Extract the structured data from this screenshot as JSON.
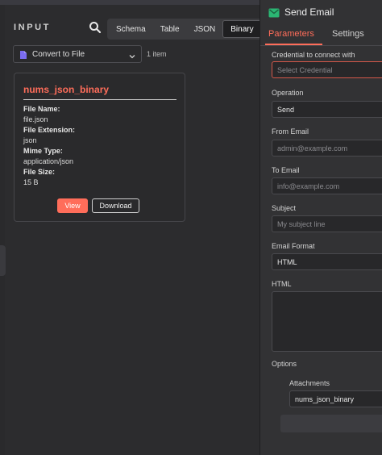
{
  "input_panel": {
    "title": "INPUT",
    "search_icon": "search-icon",
    "tabs": [
      {
        "label": "Schema",
        "active": false
      },
      {
        "label": "Table",
        "active": false
      },
      {
        "label": "JSON",
        "active": false
      },
      {
        "label": "Binary",
        "active": true
      }
    ],
    "node_select": {
      "value": "Convert to File",
      "icon": "convert-to-file-icon"
    },
    "item_count": "1 item",
    "binary_card": {
      "title": "nums_json_binary",
      "file_name_label": "File Name:",
      "file_name": "file.json",
      "file_extension_label": "File Extension:",
      "file_extension": "json",
      "mime_type_label": "Mime Type:",
      "mime_type": "application/json",
      "file_size_label": "File Size:",
      "file_size": "15 B",
      "view_label": "View",
      "download_label": "Download"
    }
  },
  "node_panel": {
    "title": "Send Email",
    "icon": "mail-icon",
    "tabs": [
      {
        "label": "Parameters",
        "active": true
      },
      {
        "label": "Settings",
        "active": false
      }
    ],
    "fields": {
      "credential": {
        "label": "Credential to connect with",
        "placeholder": "Select Credential"
      },
      "operation": {
        "label": "Operation",
        "value": "Send"
      },
      "from_email": {
        "label": "From Email",
        "placeholder": "admin@example.com"
      },
      "to_email": {
        "label": "To Email",
        "placeholder": "info@example.com"
      },
      "subject": {
        "label": "Subject",
        "placeholder": "My subject line"
      },
      "email_format": {
        "label": "Email Format",
        "value": "HTML"
      },
      "html": {
        "label": "HTML",
        "value": ""
      }
    },
    "options": {
      "label": "Options",
      "attachments_label": "Attachments",
      "attachments_value": "nums_json_binary"
    }
  },
  "colors": {
    "accent": "#ff6d5a",
    "mail_icon": "#2bb673"
  }
}
